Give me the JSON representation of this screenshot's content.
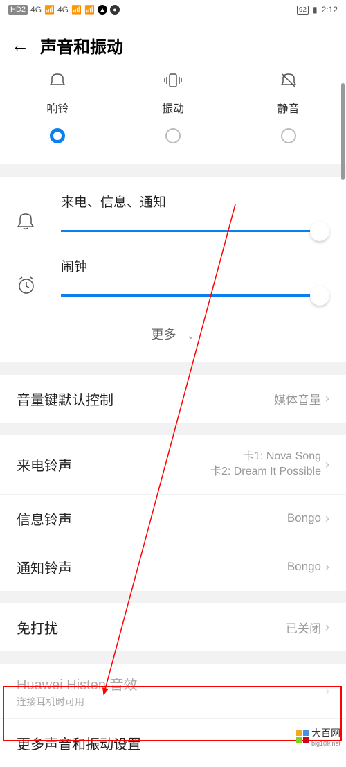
{
  "status_bar": {
    "hd_icon": "HD2",
    "sig1": "4G",
    "sig2": "4G",
    "battery": "92",
    "time": "2:12"
  },
  "header": {
    "title": "声音和振动"
  },
  "modes": {
    "ring": "响铃",
    "vibrate": "振动",
    "silent": "静音",
    "selected": "ring"
  },
  "volume": {
    "ringtone_label": "来电、信息、通知",
    "alarm_label": "闹钟",
    "more_label": "更多"
  },
  "settings": {
    "volume_key": {
      "label": "音量键默认控制",
      "value": "媒体音量"
    },
    "ringtone": {
      "label": "来电铃声",
      "line1": "卡1: Nova Song",
      "line2": "卡2: Dream It Possible"
    },
    "message": {
      "label": "信息铃声",
      "value": "Bongo"
    },
    "notify": {
      "label": "通知铃声",
      "value": "Bongo"
    },
    "dnd": {
      "label": "免打扰",
      "value": "已关闭"
    },
    "histen": {
      "label": "Huawei Histen 音效",
      "sub": "连接耳机时可用"
    },
    "more_settings": {
      "label": "更多声音和振动设置"
    }
  },
  "watermark": {
    "text": "大百网",
    "url": "big100.net"
  }
}
